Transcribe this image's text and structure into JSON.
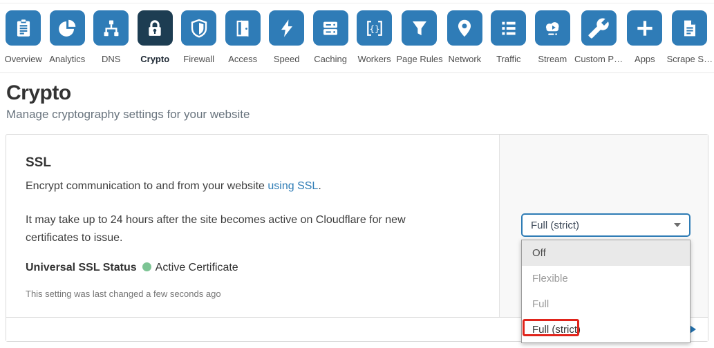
{
  "nav": {
    "tabs": [
      {
        "label": "Overview",
        "icon": "overview-icon",
        "selected": false
      },
      {
        "label": "Analytics",
        "icon": "analytics-icon",
        "selected": false
      },
      {
        "label": "DNS",
        "icon": "dns-icon",
        "selected": false
      },
      {
        "label": "Crypto",
        "icon": "crypto-icon",
        "selected": true
      },
      {
        "label": "Firewall",
        "icon": "firewall-icon",
        "selected": false
      },
      {
        "label": "Access",
        "icon": "access-icon",
        "selected": false
      },
      {
        "label": "Speed",
        "icon": "speed-icon",
        "selected": false
      },
      {
        "label": "Caching",
        "icon": "caching-icon",
        "selected": false
      },
      {
        "label": "Workers",
        "icon": "workers-icon",
        "selected": false
      },
      {
        "label": "Page Rules",
        "icon": "page-rules-icon",
        "selected": false
      },
      {
        "label": "Network",
        "icon": "network-icon",
        "selected": false
      },
      {
        "label": "Traffic",
        "icon": "traffic-icon",
        "selected": false
      },
      {
        "label": "Stream",
        "icon": "stream-icon",
        "selected": false
      },
      {
        "label": "Custom P…",
        "icon": "custom-pages-icon",
        "selected": false
      },
      {
        "label": "Apps",
        "icon": "apps-icon",
        "selected": false
      },
      {
        "label": "Scrape S…",
        "icon": "scrape-shield-icon",
        "selected": false
      }
    ]
  },
  "page": {
    "title": "Crypto",
    "subtitle": "Manage cryptography settings for your website"
  },
  "ssl": {
    "heading": "SSL",
    "desc_prefix": "Encrypt communication to and from your website ",
    "desc_link": "using SSL",
    "desc_suffix": ".",
    "note": "It may take up to 24 hours after the site becomes active on Cloudflare for new certificates to issue.",
    "status_label": "Universal SSL Status",
    "status_value": "Active Certificate",
    "last_changed": "This setting was last changed a few seconds ago",
    "dropdown": {
      "value": "Full (strict)",
      "options": [
        "Off",
        "Flexible",
        "Full",
        "Full (strict)"
      ],
      "highlighted_option": "Off",
      "annotated_option": "Full (strict)"
    }
  },
  "colors": {
    "tab_blue": "#2f7cb7",
    "tab_selected_navy": "#1d3d52",
    "link_blue": "#2e7cb5",
    "select_focus_border": "#2e7cb5",
    "status_green": "#7cc494",
    "annotation_red": "#e0241b",
    "next_arrow_blue": "#2170ad"
  }
}
